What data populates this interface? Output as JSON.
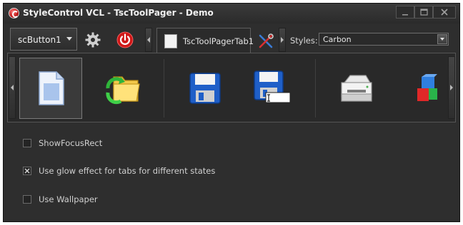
{
  "window": {
    "title": "StyleControl VCL - TscToolPager - Demo",
    "controls": [
      "minimize",
      "maximize",
      "close"
    ]
  },
  "toolbar": {
    "combo_value": "scButton1",
    "gear_icon": "gear-icon",
    "power_icon": "power-icon",
    "tab_label": "TscToolPagerTab1",
    "tools_icon": "tools-icon",
    "styles_label": "Styles:",
    "styles_value": "Carbon"
  },
  "pager": {
    "items": [
      {
        "icon": "document-icon",
        "selected": true
      },
      {
        "icon": "folder-refresh-icon",
        "selected": false
      },
      {
        "icon": "floppy-save-icon",
        "selected": false
      },
      {
        "icon": "floppy-save-as-icon",
        "selected": false
      },
      {
        "icon": "printer-icon",
        "selected": false
      },
      {
        "icon": "cubes-icon",
        "selected": false
      }
    ]
  },
  "options": [
    {
      "label": "ShowFocusRect",
      "checked": false
    },
    {
      "label": "Use glow effect for tabs for different states",
      "checked": true
    },
    {
      "label": "Use Wallpaper",
      "checked": false
    }
  ],
  "colors": {
    "window_bg": "#2e2e2e",
    "accent_red": "#d01818",
    "floppy_blue": "#1f5fc8"
  }
}
